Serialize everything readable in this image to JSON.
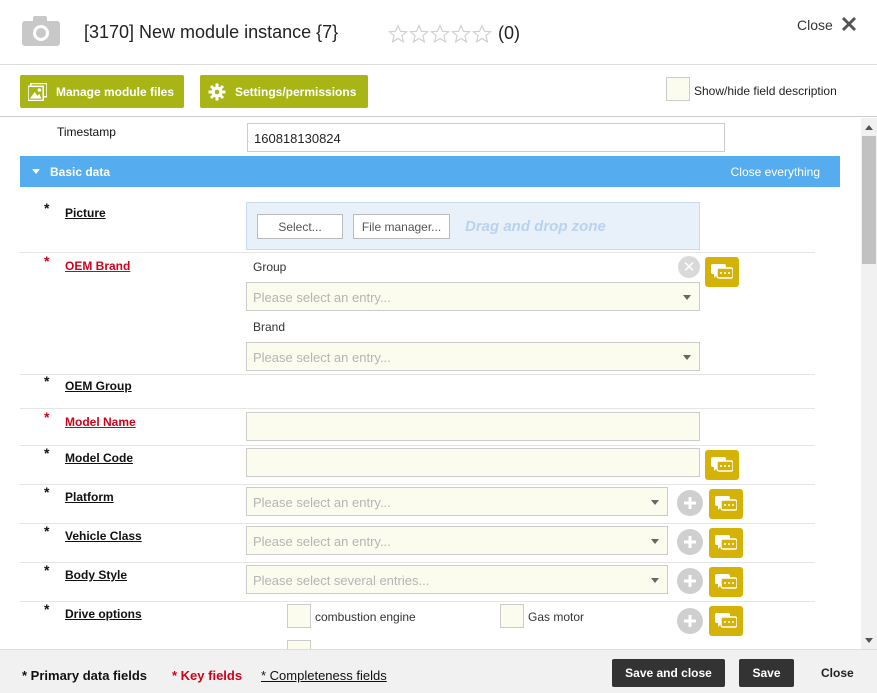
{
  "header": {
    "title": "[3170] New module instance {7}",
    "rating": "(0)",
    "close_label": "Close",
    "star_count": 5
  },
  "toolbar": {
    "manage_files": "Manage module files",
    "settings": "Settings/permissions",
    "show_hide": "Show/hide field description"
  },
  "timestamp": {
    "label": "Timestamp",
    "value": "160818130824"
  },
  "section": {
    "title": "Basic data",
    "close_all": "Close everything"
  },
  "fields": {
    "picture": {
      "label": "Picture",
      "select_btn": "Select...",
      "file_manager_btn": "File manager...",
      "drop_zone": "Drag and drop zone"
    },
    "oem_brand": {
      "label": "OEM Brand",
      "group_label": "Group",
      "group_placeholder": "Please select an entry...",
      "brand_label": "Brand",
      "brand_placeholder": "Please select an entry..."
    },
    "oem_group": {
      "label": "OEM Group"
    },
    "model_name": {
      "label": "Model Name",
      "value": ""
    },
    "model_code": {
      "label": "Model Code",
      "value": ""
    },
    "platform": {
      "label": "Platform",
      "placeholder": "Please select an entry..."
    },
    "vehicle_class": {
      "label": "Vehicle Class",
      "placeholder": "Please select an entry..."
    },
    "body_style": {
      "label": "Body Style",
      "placeholder": "Please select several entries..."
    },
    "drive_options": {
      "label": "Drive options",
      "options": [
        "combustion engine",
        "Gas motor"
      ]
    }
  },
  "footer": {
    "primary": "* Primary data fields",
    "key": "* Key fields",
    "completeness": "* Completeness fields",
    "save_close": "Save and close",
    "save": "Save",
    "close": "Close"
  },
  "colors": {
    "toolbar_button": "#a8b515",
    "section_bar": "#55acee",
    "comment_button": "#d4b306",
    "key_field": "#d0021b",
    "dark_button": "#333333"
  }
}
